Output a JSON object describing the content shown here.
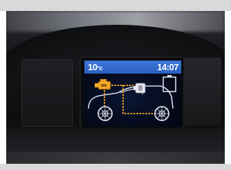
{
  "display": {
    "temperature": "10",
    "temperature_unit": "°c",
    "time": "14:07"
  },
  "energy_flow": {
    "engine_active": true,
    "motor_active": true,
    "battery_level": 0
  },
  "colors": {
    "status_bar": "#3c78d8",
    "flow_line": "#f5a623",
    "engine_icon": "#f5a623",
    "outline": "#d8dde6"
  },
  "icons": [
    "engine-icon",
    "motor-icon",
    "battery-icon",
    "car-outline-icon",
    "wheel-icon"
  ]
}
